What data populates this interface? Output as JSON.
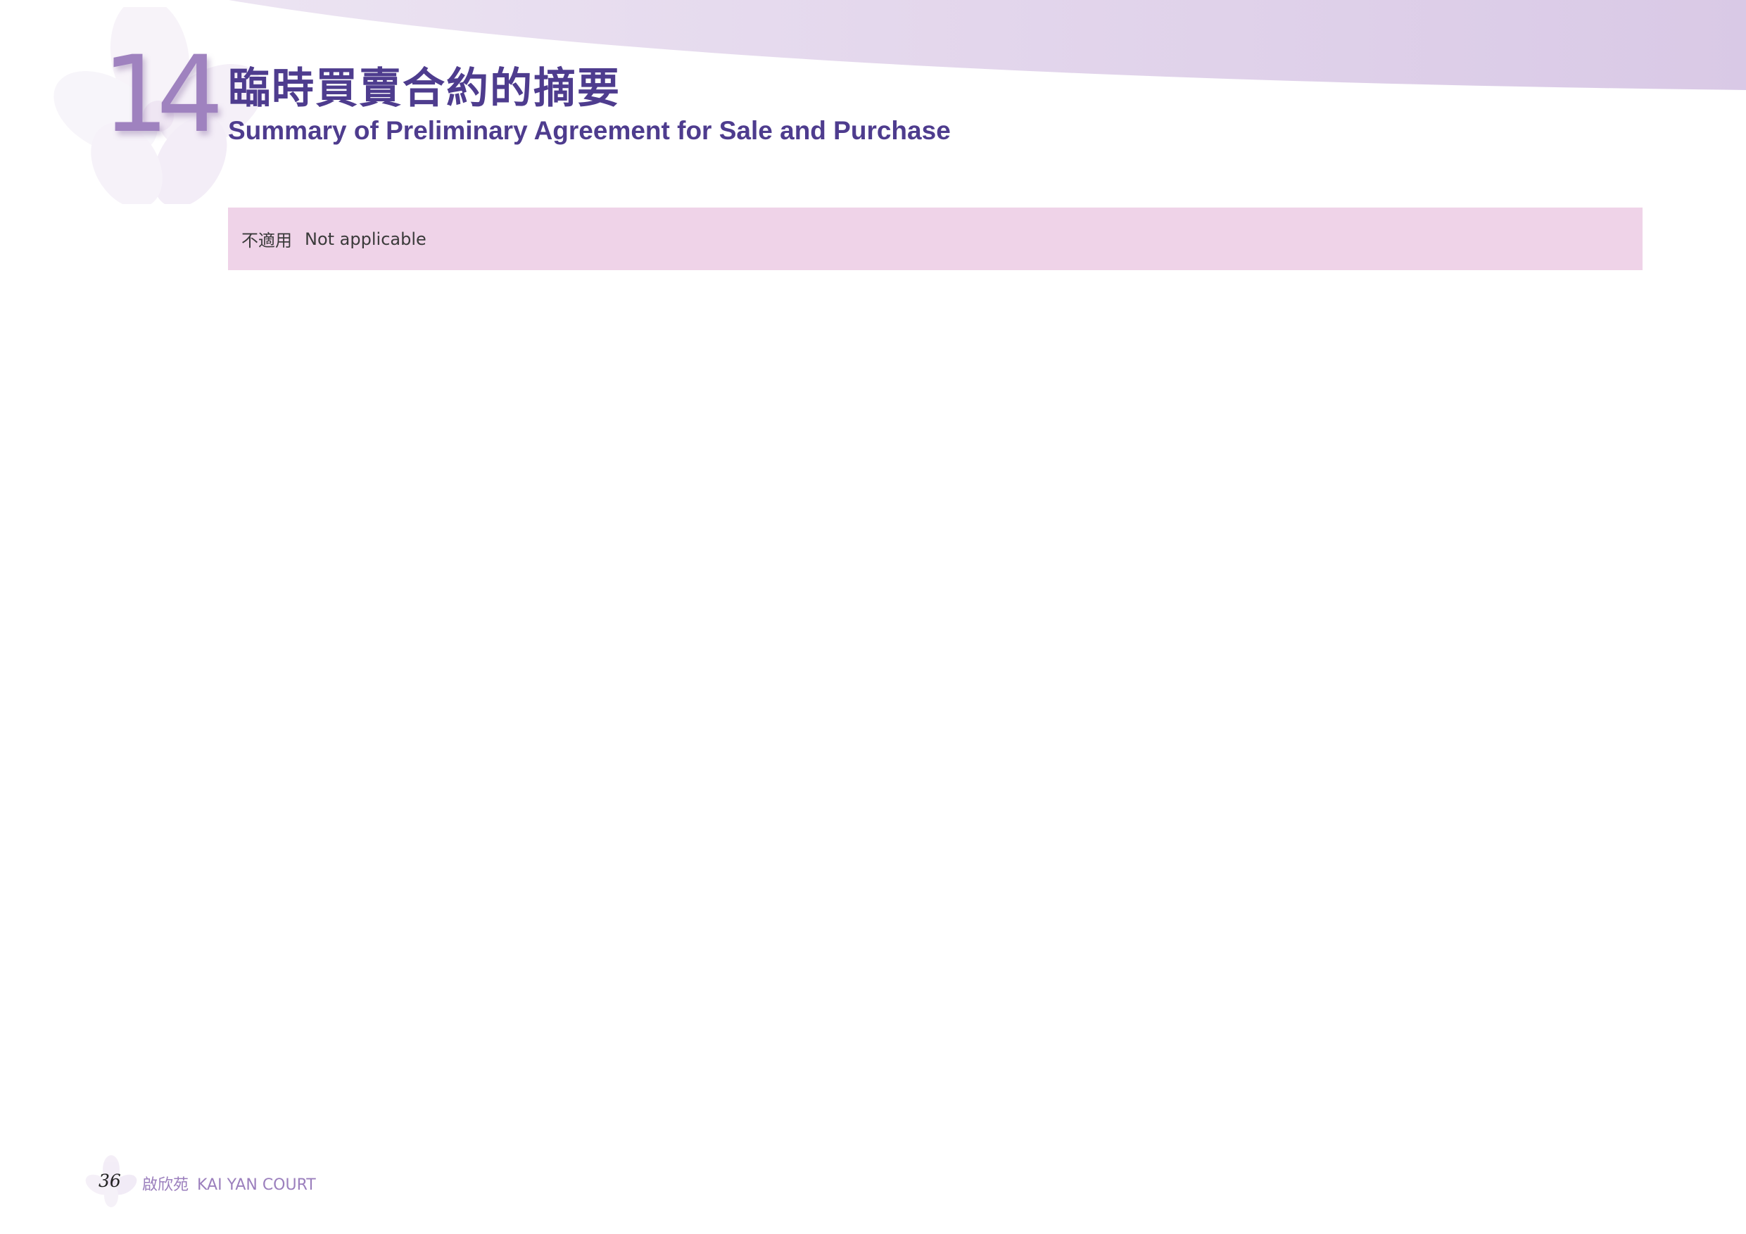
{
  "header": {
    "chapter_number": "14",
    "title_zh": "臨時買賣合約的摘要",
    "title_en": "Summary of Preliminary Agreement for Sale and Purchase"
  },
  "notice": {
    "text_zh": "不適用",
    "text_en": "Not applicable"
  },
  "footer": {
    "page_number": "36",
    "brand_zh": "啟欣苑",
    "brand_en": "KAI YAN COURT"
  },
  "colors": {
    "title": "#4e3c8e",
    "chapter_number": "#9f82bf",
    "notice_bg": "#efd3e8",
    "band": "#e4d8ec",
    "footer_text": "#9b7fbd"
  }
}
